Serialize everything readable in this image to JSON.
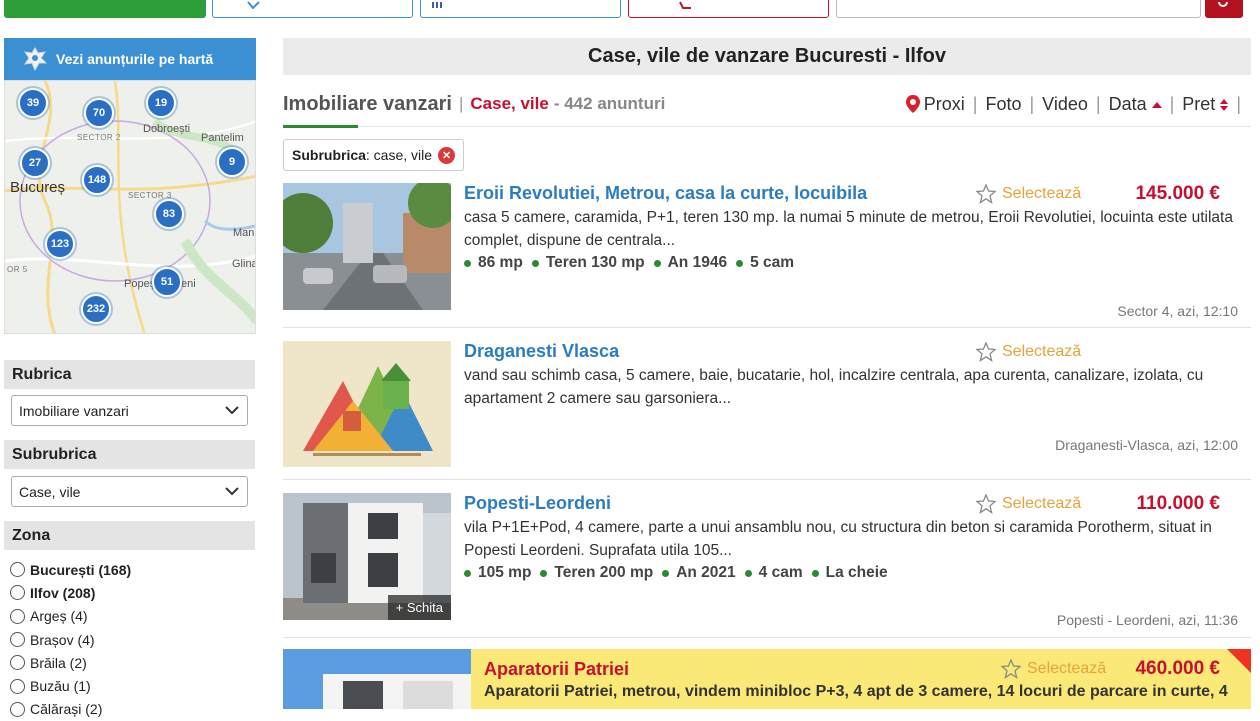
{
  "map_header": {
    "label": "Vezi anunțurile pe hartă"
  },
  "map": {
    "labels": {
      "city": "Bucureș",
      "dobroesti": "Dobroești",
      "pantelim": "Pantelim",
      "sector2": "SECTOR 2",
      "sector3": "SECTOR 3",
      "popesti": "Popești-L",
      "popesti2": "eni",
      "man": "Man",
      "glina": "Glina",
      "or5": "OR 5"
    },
    "pins": [
      "39",
      "70",
      "19",
      "27",
      "148",
      "9",
      "83",
      "123",
      "51",
      "232"
    ]
  },
  "sidebar": {
    "rubrica_title": "Rubrica",
    "rubrica_value": "Imobiliare vanzari",
    "subrubrica_title": "Subrubrica",
    "subrubrica_value": "Case, vile",
    "zona_title": "Zona",
    "zones": [
      {
        "label": "București (168)"
      },
      {
        "label": "Ilfov (208)"
      },
      {
        "label": "Argeș (4)"
      },
      {
        "label": "Brașov (4)"
      },
      {
        "label": "Brăila (2)"
      },
      {
        "label": "Buzău (1)"
      },
      {
        "label": "Călărași (2)"
      }
    ]
  },
  "main": {
    "title": "Case, vile de vanzare Bucuresti - Ilfov",
    "rubrica": "Imobiliare vanzari",
    "separator": "|",
    "subrubrica": "Case, vile",
    "count": "- 442 anunturi",
    "sort": {
      "proxi": "Proxi",
      "foto": "Foto",
      "video": "Video",
      "data": "Data",
      "pret": "Pret"
    },
    "filter": {
      "key": "Subrubrica",
      "value": ": case, vile"
    }
  },
  "listings": [
    {
      "title": "Eroii Revolutiei, Metrou, casa la curte, locuibila",
      "desc": "casa 5 camere, caramida, P+1, teren 130 mp. la numai 5 minute de metrou, Eroii Revolutiei, locuinta este utilata complet, dispune de centrala...",
      "features": [
        "86 mp",
        "Teren 130 mp",
        "An 1946",
        "5 cam"
      ],
      "select_label": "Selectează",
      "price": "145.000 €",
      "location": "Sector 4, azi, 12:10"
    },
    {
      "title": "Draganesti Vlasca",
      "desc": "vand sau schimb casa, 5 camere, baie, bucatarie, hol, incalzire centrala, apa curenta, canalizare, izolata, cu apartament 2 camere sau garsoniera...",
      "features": [],
      "select_label": "Selectează",
      "price": "",
      "location": "Draganesti-Vlasca, azi, 12:00"
    },
    {
      "title": "Popesti-Leordeni",
      "desc": "vila P+1E+Pod, 4 camere, parte a unui ansamblu nou, cu structura din beton si caramida Porotherm, situat in Popesti Leordeni. Suprafata utila 105...",
      "features": [
        "105 mp",
        "Teren 200 mp",
        "An 2021",
        "4 cam",
        "La cheie"
      ],
      "select_label": "Selectează",
      "price": "110.000 €",
      "location": "Popesti - Leordeni, azi, 11:36",
      "badge": "+ Schita"
    }
  ],
  "promo": {
    "title": "Aparatorii Patriei",
    "desc": "Aparatorii Patriei, metrou, vindem minibloc P+3, 4 apt de 3 camere, 14 locuri de parcare in curte, 4",
    "select_label": "Selectează",
    "price": "460.000 €"
  }
}
